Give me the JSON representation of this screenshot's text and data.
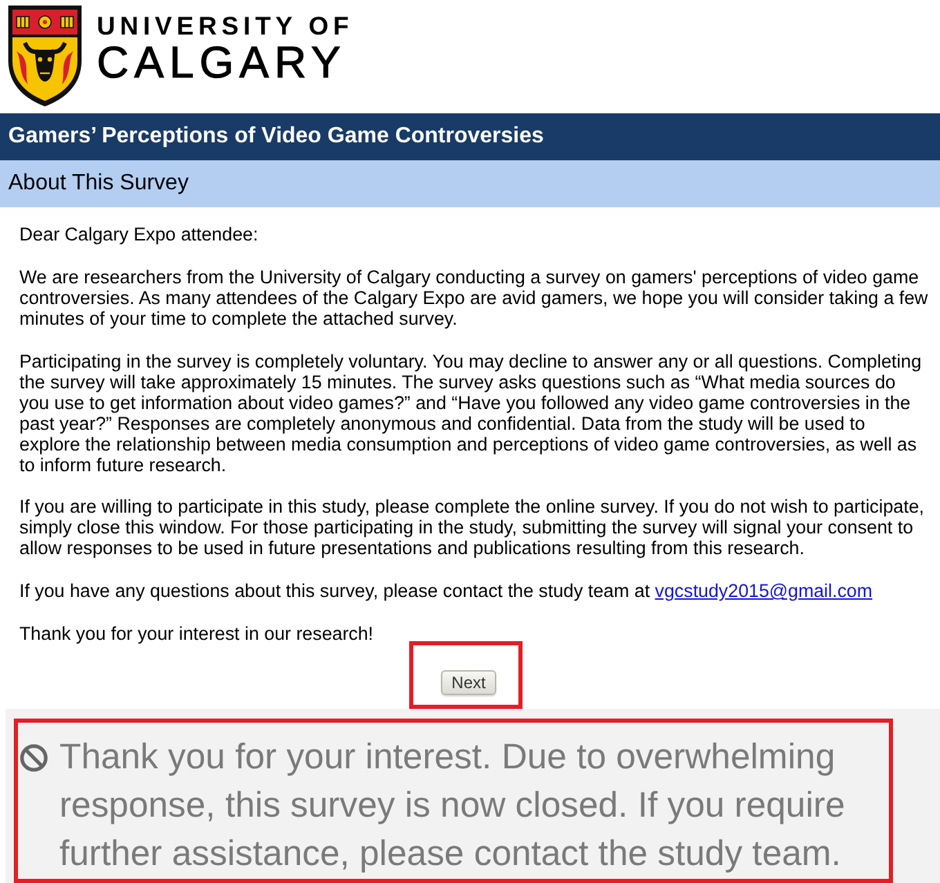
{
  "header": {
    "logo_line_1": "UNIVERSITY OF",
    "logo_line_2": "CALGARY"
  },
  "title_bar": {
    "title": "Gamers’ Perceptions of Video Game Controversies"
  },
  "section_bar": {
    "title": "About This Survey"
  },
  "letter": {
    "greeting": "Dear Calgary Expo attendee:",
    "paragraphs": [
      "We are researchers from the University of Calgary conducting a survey on gamers' perceptions of video game controversies. As many attendees of the Calgary Expo are avid gamers, we hope you will consider taking a few minutes of your time to complete the attached survey.",
      "Participating in the survey is completely voluntary. You may decline to answer any or all questions. Completing the survey will take approximately 15 minutes. The survey asks questions such as “What media sources do you use to get information about video games?” and “Have you followed any video game controversies in the past year?” Responses are completely anonymous and confidential. Data from the study will be used to explore the relationship between media consumption and perceptions of video game controversies, as well as to inform future research.",
      "If you are willing to participate in this study, please complete the online survey. If you do not wish to participate, simply close this window. For those participating in the study, submitting the survey will signal your consent to allow responses to be used in future presentations and publications resulting from this research."
    ],
    "contact": {
      "text": "If you have any questions about this survey, please contact the study team at",
      "email": "vgcstudy2015@gmail.com"
    },
    "closing": "Thank you for your interest in our research!"
  },
  "next_button": {
    "label": "Next",
    "highlighted": true
  },
  "closed_notice": {
    "message": "Thank you for your interest. Due to overwhelming response, this survey is now closed. If you require further assistance, please contact the study team.",
    "highlighted": true
  }
}
